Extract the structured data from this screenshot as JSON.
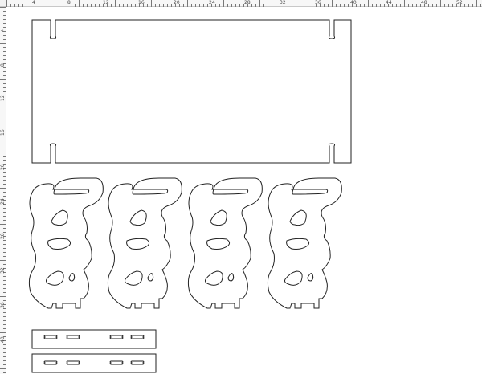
{
  "rulers": {
    "top_labels": [
      "4",
      "8",
      "12",
      "16",
      "20",
      "24",
      "28",
      "32",
      "36",
      "40",
      "44",
      "48",
      "52"
    ],
    "left_labels": [
      "4",
      "8",
      "12",
      "16",
      "20",
      "24",
      "28",
      "32",
      "36",
      "40"
    ]
  },
  "canvas": {
    "panel": "rectangular board with four slots",
    "figures_count": 4,
    "strips_count": 2
  }
}
